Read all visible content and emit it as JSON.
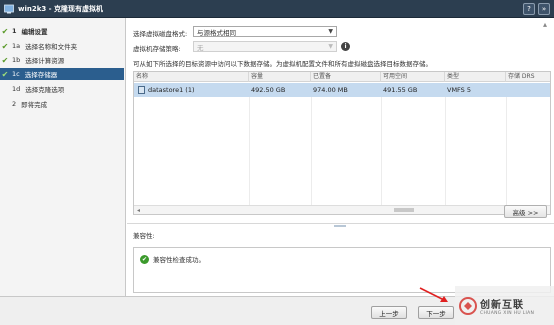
{
  "window": {
    "title": "win2k3 - 克隆现有虚拟机",
    "help_glyph": "?",
    "maximize_glyph": "»"
  },
  "nav": {
    "steps": [
      {
        "num": "1",
        "label": "编辑设置",
        "checked": true,
        "header": true
      },
      {
        "num": "1a",
        "label": "选择名称和文件夹",
        "checked": true
      },
      {
        "num": "1b",
        "label": "选择计算资源",
        "checked": true
      },
      {
        "num": "1c",
        "label": "选择存储器",
        "checked": true,
        "active": true
      },
      {
        "num": "1d",
        "label": "选择克隆选项",
        "checked": false
      },
      {
        "num": "2",
        "label": "即将完成",
        "checked": false
      }
    ],
    "check_glyph": "✔"
  },
  "form": {
    "disk_format_label": "选择虚拟磁盘格式:",
    "disk_format_value": "与源格式相同",
    "storage_policy_label": "虚拟机存储策略:",
    "storage_policy_value": "无",
    "info_glyph": "i",
    "description": "可从如下所选择的目标资源中访问以下数据存储。为虚拟机配置文件和所有虚拟磁盘选择目标数据存储。"
  },
  "table": {
    "columns": [
      "名称",
      "容量",
      "已置备",
      "可用空间",
      "类型",
      "存储 DRS"
    ],
    "rows": [
      {
        "name": "datastore1 (1)",
        "capacity": "492.50 GB",
        "provisioned": "974.00 MB",
        "free": "491.55 GB",
        "type": "VMFS 5",
        "drs": ""
      }
    ]
  },
  "advanced_button": "高级 >>",
  "compatibility": {
    "title": "兼容性:",
    "message": "兼容性检查成功。",
    "ok_glyph": "✔"
  },
  "footer": {
    "back_label": "上一步",
    "next_label": "下一步"
  },
  "watermark": {
    "cn": "创新互联",
    "en": "CHUANG XIN HU LIAN"
  },
  "colors": {
    "titlebar": "#2c3e50",
    "nav_active": "#2b5e8e",
    "row_selected": "#c5daef",
    "annotation_arrow": "#e02020"
  }
}
